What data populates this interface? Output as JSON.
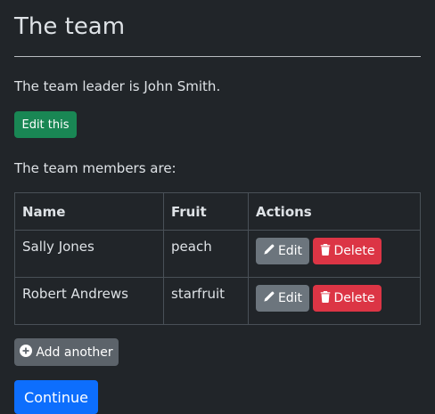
{
  "page": {
    "title": "The team",
    "leader_text": "The team leader is John Smith.",
    "edit_leader_label": "Edit this",
    "members_label": "The team members are:"
  },
  "table": {
    "headers": [
      "Name",
      "Fruit",
      "Actions"
    ],
    "rows": [
      {
        "name": "Sally Jones",
        "fruit": "peach",
        "edit_label": "Edit",
        "delete_label": "Delete"
      },
      {
        "name": "Robert Andrews",
        "fruit": "starfruit",
        "edit_label": "Edit",
        "delete_label": "Delete"
      }
    ]
  },
  "actions": {
    "add_label": "Add another",
    "continue_label": "Continue"
  },
  "icons": {
    "edit": "pencil-icon",
    "delete": "trash-icon",
    "add": "plus-circle-icon"
  },
  "colors": {
    "background": "#212529",
    "success": "#198754",
    "secondary": "#6c757d",
    "danger": "#dc3545",
    "primary": "#0d6efd"
  }
}
